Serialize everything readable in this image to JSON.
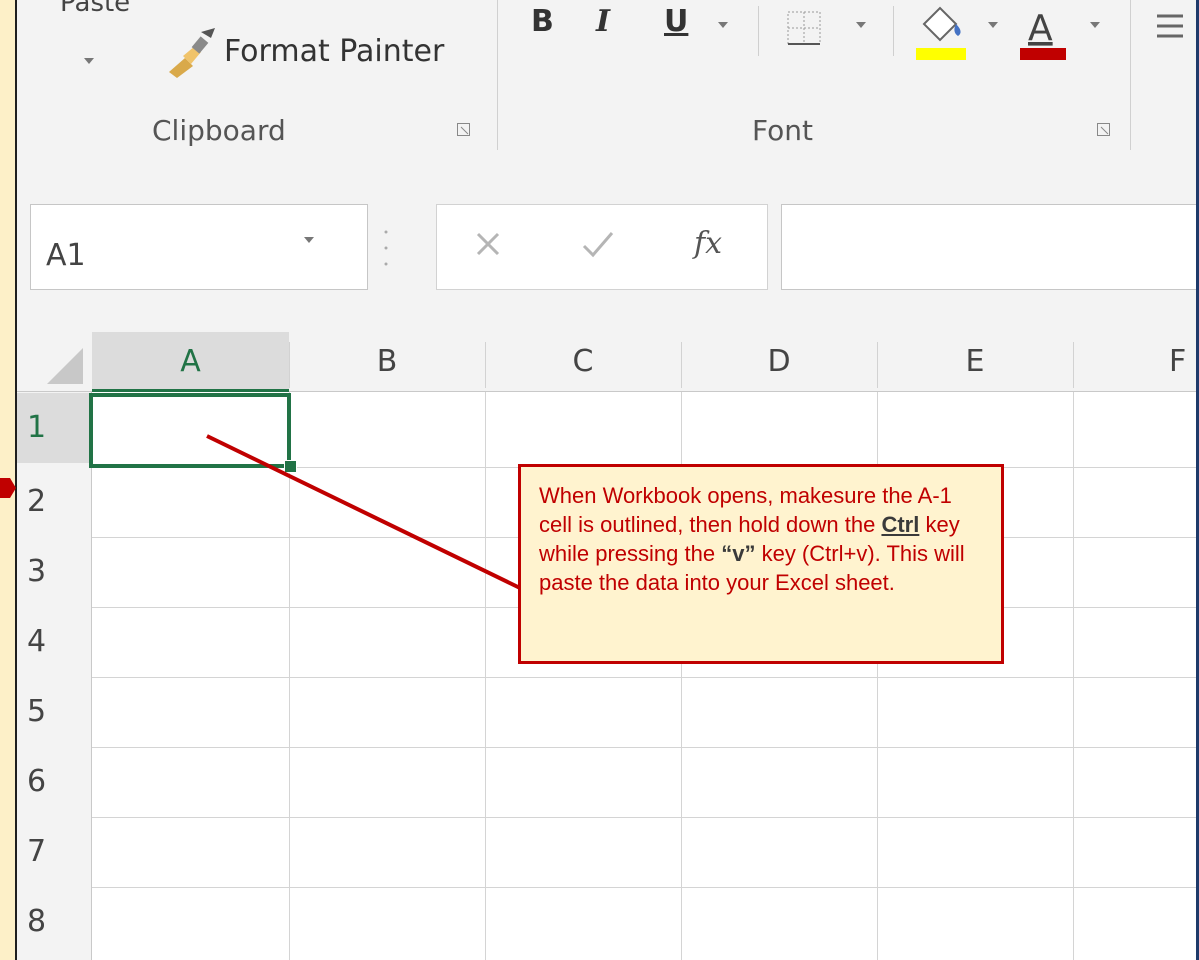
{
  "ribbon": {
    "clipboard": {
      "paste_label": "Paste",
      "format_painter_label": "Format Painter",
      "group_label": "Clipboard"
    },
    "font": {
      "bold": "B",
      "italic": "I",
      "underline": "U",
      "group_label": "Font"
    }
  },
  "formula_bar": {
    "name_box_value": "A1",
    "fx_label": "fx",
    "formula_value": ""
  },
  "grid": {
    "columns": [
      "A",
      "B",
      "C",
      "D",
      "E",
      "F"
    ],
    "rows": [
      "1",
      "2",
      "3",
      "4",
      "5",
      "6",
      "7",
      "8"
    ],
    "active_cell": "A1"
  },
  "callout": {
    "text_1": "When Workbook opens, makesure the A-1 cell is outlined, then hold down the ",
    "key_ctrl": "Ctrl",
    "text_2": " key while pressing the ",
    "key_v": "“v”",
    "text_3": " key (Ctrl+v). This will paste the data into your Excel sheet."
  },
  "colors": {
    "accent_green": "#217346",
    "callout_red": "#c00000",
    "callout_bg": "#fff3cf",
    "margin_beige": "#fdf0c8"
  }
}
